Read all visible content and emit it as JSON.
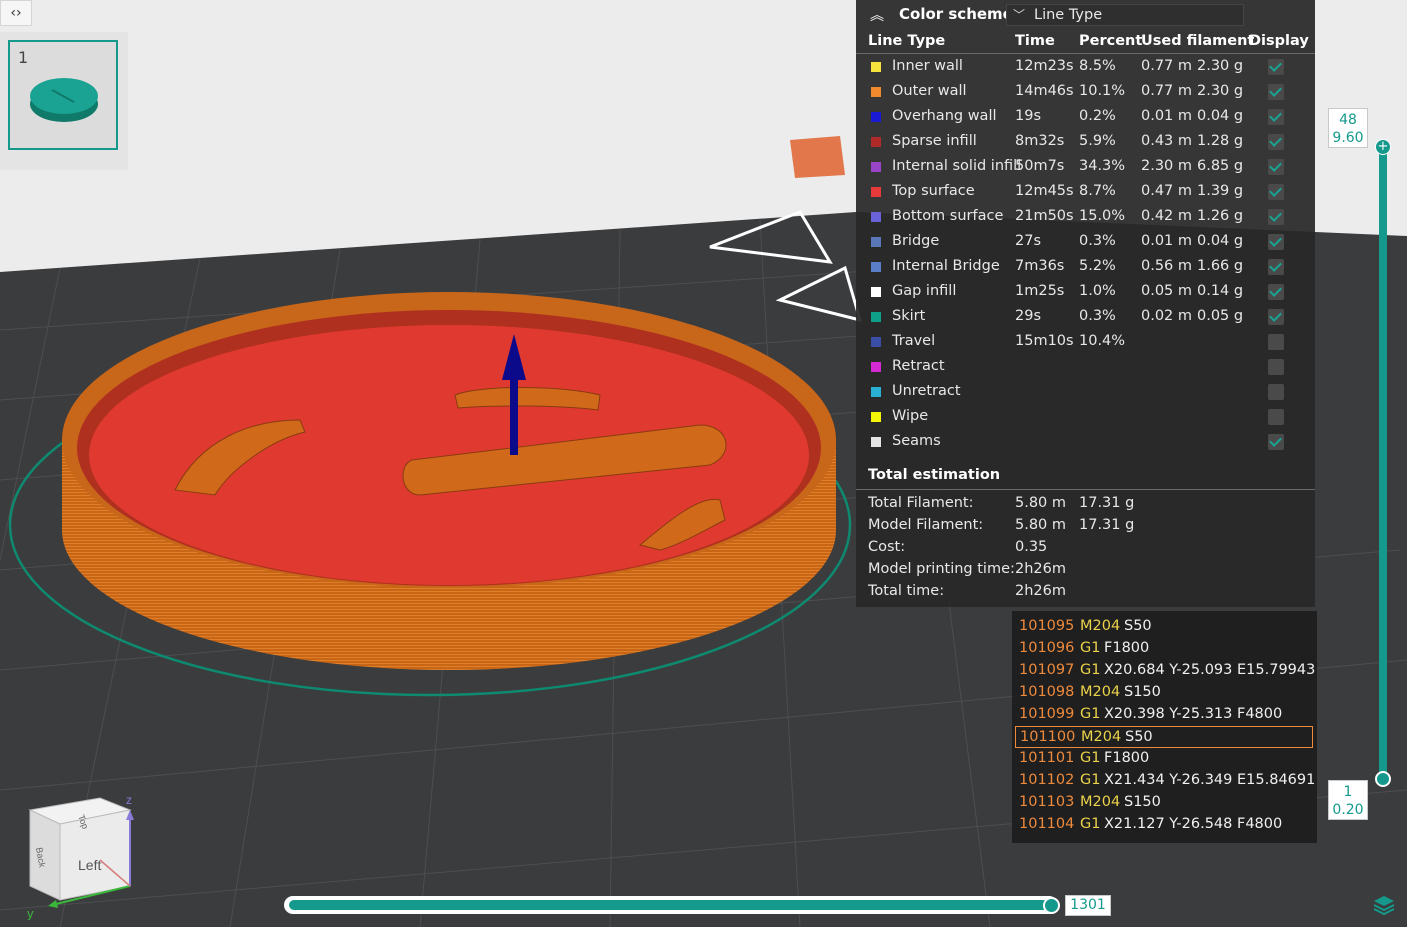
{
  "plate": {
    "number": "1"
  },
  "legend": {
    "title": "Color scheme",
    "scheme_value": "Line Type",
    "headers": {
      "line_type": "Line Type",
      "time": "Time",
      "percent": "Percent",
      "used_filament": "Used filament",
      "display": "Display"
    },
    "rows": [
      {
        "name": "Inner wall",
        "color": "#f5e23a",
        "time": "12m23s",
        "percent": "8.5%",
        "length": "0.77 m",
        "weight": "2.30 g",
        "display": true
      },
      {
        "name": "Outer wall",
        "color": "#f08a2c",
        "time": "14m46s",
        "percent": "10.1%",
        "length": "0.77 m",
        "weight": "2.30 g",
        "display": true
      },
      {
        "name": "Overhang wall",
        "color": "#1a1ad4",
        "time": "19s",
        "percent": "0.2%",
        "length": "0.01 m",
        "weight": "0.04 g",
        "display": true
      },
      {
        "name": "Sparse infill",
        "color": "#b02a2a",
        "time": "8m32s",
        "percent": "5.9%",
        "length": "0.43 m",
        "weight": "1.28 g",
        "display": true
      },
      {
        "name": "Internal solid infill",
        "color": "#9a44c8",
        "time": "50m7s",
        "percent": "34.3%",
        "length": "2.30 m",
        "weight": "6.85 g",
        "display": true
      },
      {
        "name": "Top surface",
        "color": "#e83a3a",
        "time": "12m45s",
        "percent": "8.7%",
        "length": "0.47 m",
        "weight": "1.39 g",
        "display": true
      },
      {
        "name": "Bottom surface",
        "color": "#6a62d8",
        "time": "21m50s",
        "percent": "15.0%",
        "length": "0.42 m",
        "weight": "1.26 g",
        "display": true
      },
      {
        "name": "Bridge",
        "color": "#5a78b8",
        "time": "27s",
        "percent": "0.3%",
        "length": "0.01 m",
        "weight": "0.04 g",
        "display": true
      },
      {
        "name": "Internal Bridge",
        "color": "#5a7ec8",
        "time": "7m36s",
        "percent": "5.2%",
        "length": "0.56 m",
        "weight": "1.66 g",
        "display": true
      },
      {
        "name": "Gap infill",
        "color": "#ffffff",
        "time": "1m25s",
        "percent": "1.0%",
        "length": "0.05 m",
        "weight": "0.14 g",
        "display": true
      },
      {
        "name": "Skirt",
        "color": "#0fa08a",
        "time": "29s",
        "percent": "0.3%",
        "length": "0.02 m",
        "weight": "0.05 g",
        "display": true
      },
      {
        "name": "Travel",
        "color": "#3a4ea8",
        "time": "15m10s",
        "percent": "10.4%",
        "length": "",
        "weight": "",
        "display": false
      },
      {
        "name": "Retract",
        "color": "#d42ad4",
        "time": "",
        "percent": "",
        "length": "",
        "weight": "",
        "display": false
      },
      {
        "name": "Unretract",
        "color": "#2ab0d4",
        "time": "",
        "percent": "",
        "length": "",
        "weight": "",
        "display": false
      },
      {
        "name": "Wipe",
        "color": "#f5f50a",
        "time": "",
        "percent": "",
        "length": "",
        "weight": "",
        "display": false
      },
      {
        "name": "Seams",
        "color": "#e4e4e4",
        "time": "",
        "percent": "",
        "length": "",
        "weight": "",
        "display": true
      }
    ],
    "total_estimation": {
      "title": "Total estimation",
      "rows": [
        {
          "label": "Total Filament:",
          "v1": "5.80 m",
          "v2": "17.31 g"
        },
        {
          "label": "Model Filament:",
          "v1": "5.80 m",
          "v2": "17.31 g"
        },
        {
          "label": "Cost:",
          "v1": "0.35",
          "v2": ""
        },
        {
          "label": "Model printing time:",
          "v1": "2h26m",
          "v2": ""
        },
        {
          "label": "Total time:",
          "v1": "2h26m",
          "v2": ""
        }
      ]
    }
  },
  "gcode": {
    "lines": [
      {
        "num": "101095",
        "cmd": "M204",
        "args": "S50",
        "active": false
      },
      {
        "num": "101096",
        "cmd": "G1",
        "args": "F1800",
        "active": false
      },
      {
        "num": "101097",
        "cmd": "G1",
        "args": "X20.684 Y-25.093 E15.79943",
        "active": false
      },
      {
        "num": "101098",
        "cmd": "M204",
        "args": "S150",
        "active": false
      },
      {
        "num": "101099",
        "cmd": "G1",
        "args": "X20.398 Y-25.313 F4800",
        "active": false
      },
      {
        "num": "101100",
        "cmd": "M204",
        "args": "S50",
        "active": true
      },
      {
        "num": "101101",
        "cmd": "G1",
        "args": "F1800",
        "active": false
      },
      {
        "num": "101102",
        "cmd": "G1",
        "args": "X21.434 Y-26.349 E15.84691",
        "active": false
      },
      {
        "num": "101103",
        "cmd": "M204",
        "args": "S150",
        "active": false
      },
      {
        "num": "101104",
        "cmd": "G1",
        "args": "X21.127 Y-26.548 F4800",
        "active": false
      }
    ]
  },
  "layer_slider": {
    "top_layer": "48",
    "top_height": "9.60",
    "bottom_layer": "1",
    "bottom_height": "0.20"
  },
  "move_slider": {
    "value": "1301"
  },
  "view_cube": {
    "face_left": "Left",
    "face_top": "Top",
    "face_back": "Back",
    "axis_z": "z",
    "axis_y": "y"
  }
}
